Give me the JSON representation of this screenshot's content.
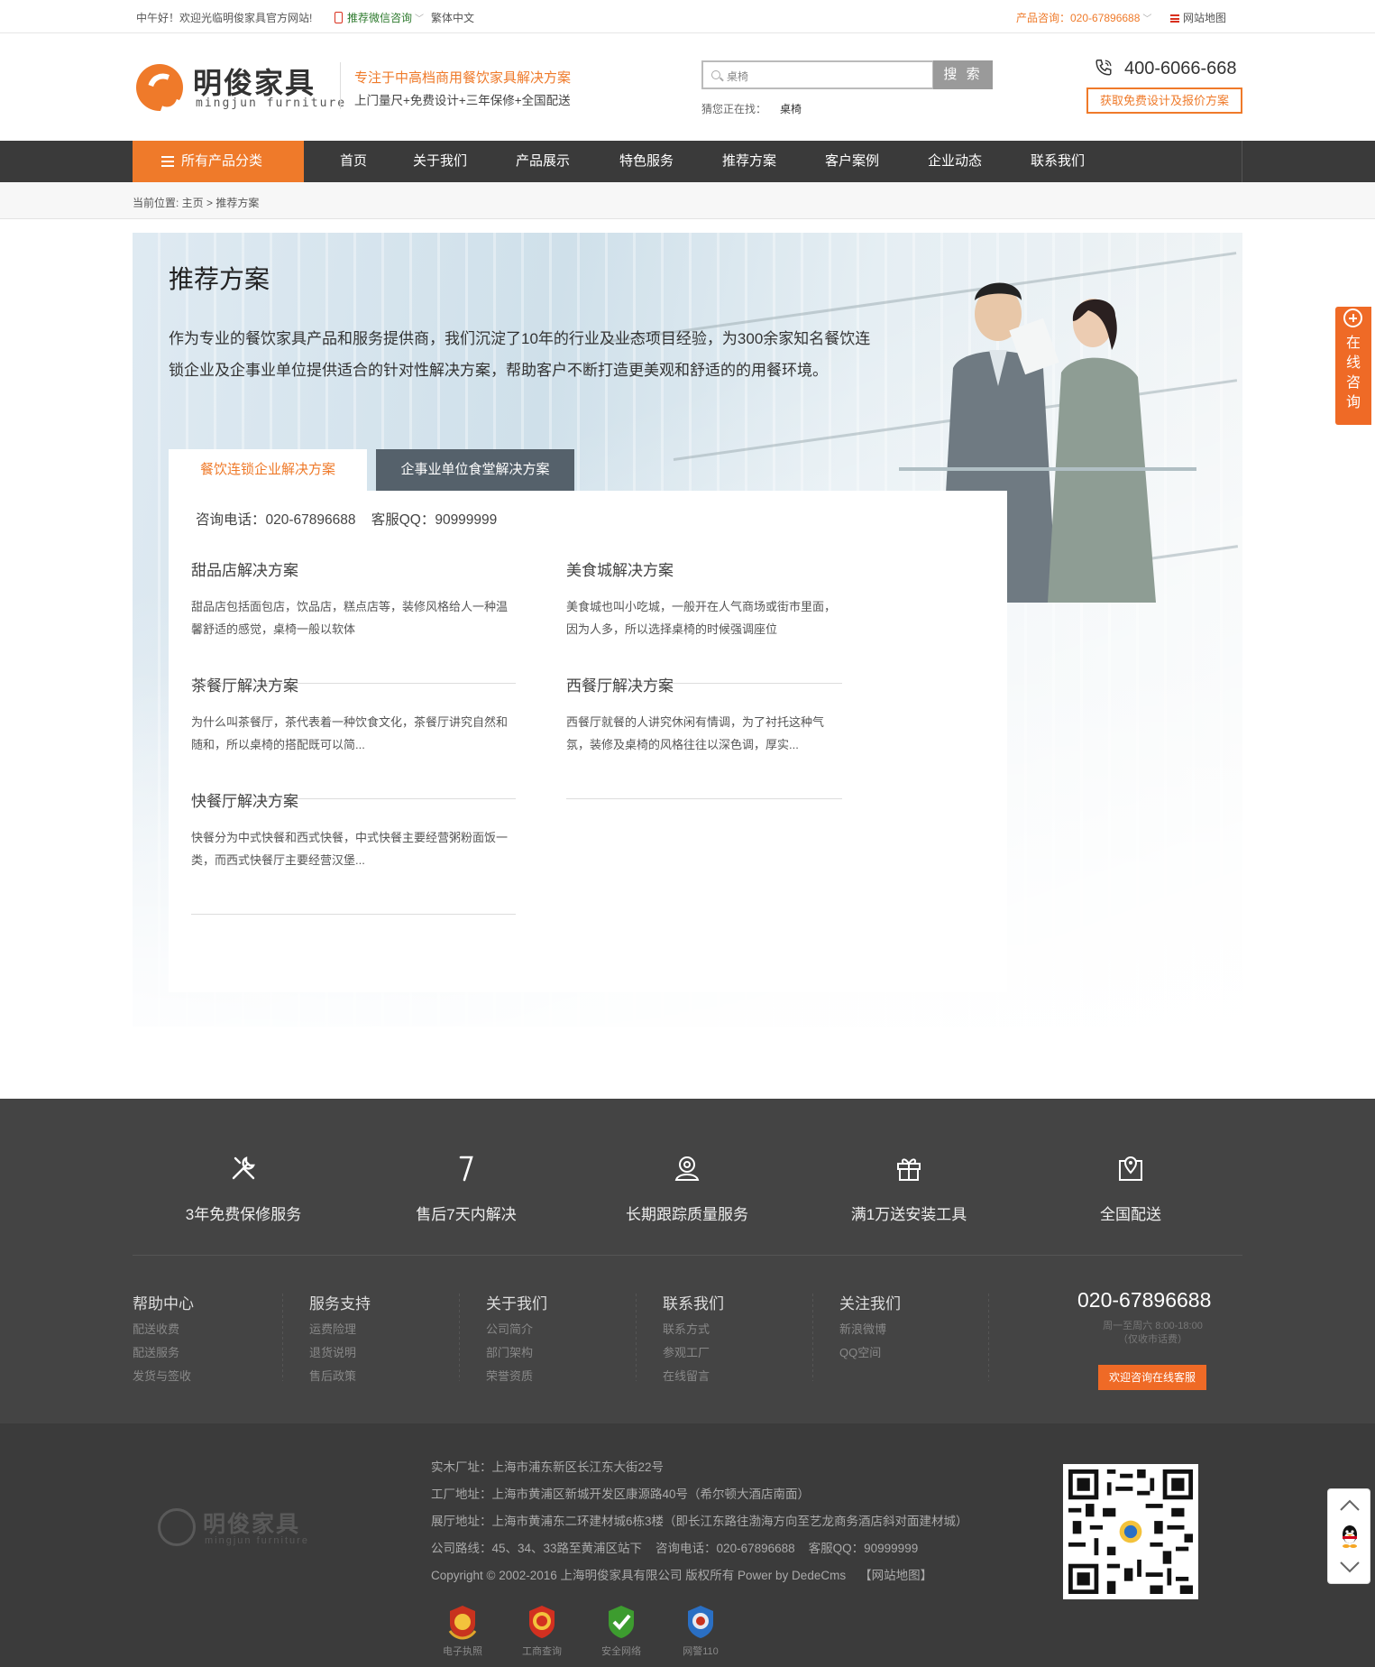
{
  "topbar": {
    "welcome": "中午好！欢迎光临明俊家具官方网站!",
    "wechat": "推荐微信咨询",
    "traditional": "繁体中文",
    "consult": "产品咨询：020-67896688",
    "sitemap": "网站地图"
  },
  "header": {
    "logo_cn": "明俊家具",
    "logo_en": "mingjun furniture",
    "tagline_1": "专注于中高档商用餐饮家具解决方案",
    "tagline_2": "上门量尺+免费设计+三年保修+全国配送",
    "search_value": "桌椅",
    "search_button": "搜 索",
    "guess_label": "猜您正在找：",
    "guess_keyword": "桌椅",
    "phone": "400-6066-668",
    "free_button": "获取免费设计及报价方案"
  },
  "nav": {
    "category": "所有产品分类",
    "items": [
      "首页",
      "关于我们",
      "产品展示",
      "特色服务",
      "推荐方案",
      "客户案例",
      "企业动态",
      "联系我们"
    ]
  },
  "breadcrumb": "当前位置: 主页 > 推荐方案",
  "banner": {
    "title": "推荐方案",
    "description": "作为专业的餐饮家具产品和服务提供商，我们沉淀了10年的行业及业态项目经验，为300余家知名餐饮连锁企业及企事业单位提供适合的针对性解决方案，帮助客户不断打造更美观和舒适的的用餐环境。",
    "tabs": [
      "餐饮连锁企业解决方案",
      "企事业单位食堂解决方案"
    ],
    "contact": "咨询电话：020-67896688    客服QQ：90999999",
    "solutions": [
      {
        "title": "甜品店解决方案",
        "desc": "甜品店包括面包店，饮品店，糕点店等，装修风格给人一种温馨舒适的感觉，桌椅一般以软体"
      },
      {
        "title": "美食城解决方案",
        "desc": "美食城也叫小吃城，一般开在人气商场或街市里面，因为人多，所以选择桌椅的时候强调座位"
      },
      {
        "title": "茶餐厅解决方案",
        "desc": "为什么叫茶餐厅，茶代表着一种饮食文化，茶餐厅讲究自然和随和，所以桌椅的搭配既可以简..."
      },
      {
        "title": "西餐厅解决方案",
        "desc": "西餐厅就餐的人讲究休闲有情调，为了衬托这种气氛，装修及桌椅的风格往往以深色调，厚实..."
      },
      {
        "title": "快餐厅解决方案",
        "desc": "快餐分为中式快餐和西式快餐，中式快餐主要经营粥粉面饭一类，而西式快餐厅主要经营汉堡..."
      }
    ]
  },
  "side": {
    "consult": "在线咨询"
  },
  "features": [
    {
      "icon": "tools-icon",
      "label": "3年免费保修服务"
    },
    {
      "icon": "seven-icon",
      "label": "售后7天内解决"
    },
    {
      "icon": "user-location-icon",
      "label": "长期跟踪质量服务"
    },
    {
      "icon": "gift-icon",
      "label": "满1万送安装工具"
    },
    {
      "icon": "map-pin-icon",
      "label": "全国配送"
    }
  ],
  "footer_cols": [
    {
      "title": "帮助中心",
      "links": [
        "配送收费",
        "配送服务",
        "发货与签收"
      ]
    },
    {
      "title": "服务支持",
      "links": [
        "运费险理",
        "退货说明",
        "售后政策"
      ]
    },
    {
      "title": "关于我们",
      "links": [
        "公司简介",
        "部门架构",
        "荣誉资质"
      ]
    },
    {
      "title": "联系我们",
      "links": [
        "联系方式",
        "参观工厂",
        "在线留言"
      ]
    },
    {
      "title": "关注我们",
      "links": [
        "新浪微博",
        "QQ空间"
      ]
    }
  ],
  "footer_contact": {
    "phone": "020-67896688",
    "hours": "周一至周六 8:00-18:00",
    "note": "（仅收市话费）",
    "button": "欢迎咨询在线客服"
  },
  "bottom": {
    "logo_cn": "明俊家具",
    "logo_en": "mingjun furniture",
    "lines": [
      "实木厂址：上海市浦东新区长江东大街22号",
      "工厂地址：上海市黄浦区新城开发区康源路40号（希尔顿大酒店南面）",
      "展厅地址：上海市黄浦东二环建材城6栋3楼（即长江东路往渤海方向至艺龙商务酒店斜对面建材城）",
      "公司路线：45、34、33路至黄浦区站下    咨询电话：020-67896688    客服QQ：90999999",
      "Copyright © 2002-2016 上海明俊家具有限公司 版权所有 Power by DedeCms    【网站地图】"
    ],
    "badges": [
      "电子执照",
      "工商查询",
      "安全网络",
      "网警110"
    ]
  },
  "colors": {
    "accent": "#ef7a2a",
    "nav": "#3a3a3a",
    "footer": "#444444",
    "bottom": "#3b3b3b"
  }
}
